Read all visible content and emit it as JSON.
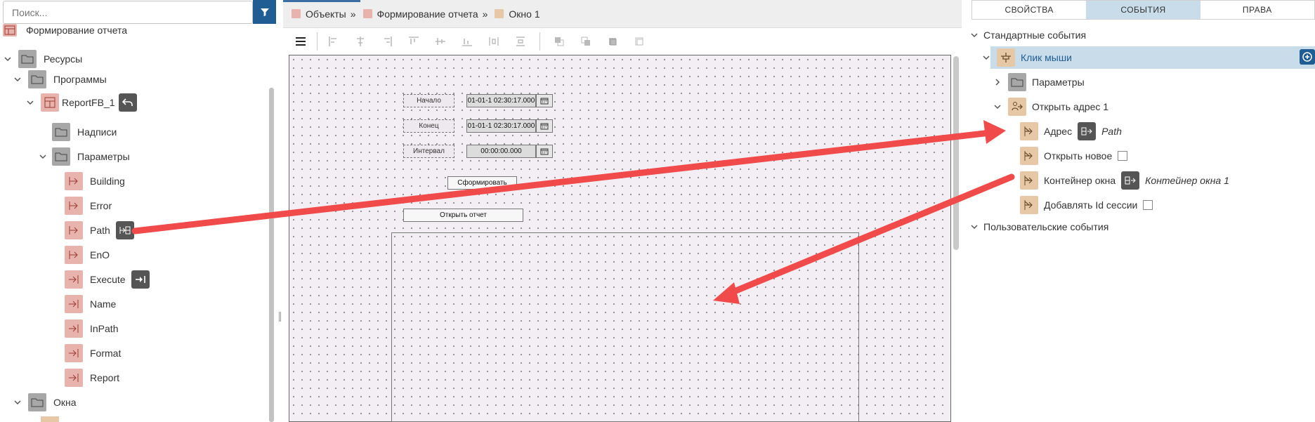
{
  "left_panel": {
    "search_placeholder": "Поиск...",
    "tree": [
      {
        "label": "Формирование отчета"
      },
      {
        "label": "Ресурсы"
      },
      {
        "label": "Программы"
      },
      {
        "label": "ReportFB_1"
      },
      {
        "label": "Надписи"
      },
      {
        "label": "Параметры"
      },
      {
        "label": "Building"
      },
      {
        "label": "Error"
      },
      {
        "label": "Path"
      },
      {
        "label": "EnO"
      },
      {
        "label": "Execute"
      },
      {
        "label": "Name"
      },
      {
        "label": "InPath"
      },
      {
        "label": "Format"
      },
      {
        "label": "Report"
      },
      {
        "label": "Окна"
      }
    ]
  },
  "breadcrumb": {
    "items": [
      "Объекты",
      "Формирование отчета",
      "Окно 1"
    ],
    "separator": "»"
  },
  "designer": {
    "labels": {
      "start": "Начало",
      "end": "Конец",
      "interval": "Интервал"
    },
    "values": {
      "start": "01-01-1 02:30:17.000",
      "end": "01-01-1 02:30:17.000",
      "interval": "00:00:00.000"
    },
    "generate_button": "Сформировать",
    "open_report_button": "Открыть отчет"
  },
  "right_panel": {
    "tabs": [
      "СВОЙСТВА",
      "СОБЫТИЯ",
      "ПРАВА"
    ],
    "active_tab": "СОБЫТИЯ",
    "standard_events": "Стандартные события",
    "mouse_click": "Клик мыши",
    "parameters": "Параметры",
    "open_address": "Открыть адрес 1",
    "address_label": "Адрес",
    "address_value": "Path",
    "open_new_label": "Открыть новое",
    "window_container_label": "Контейнер окна",
    "window_container_value": "Контейнер окна 1",
    "add_session_id_label": "Добавлять Id сессии",
    "user_events": "Пользовательские события"
  },
  "colors": {
    "accent": "#1f5d93",
    "selection": "#c8dce9",
    "arrow": "#f04a4a"
  }
}
